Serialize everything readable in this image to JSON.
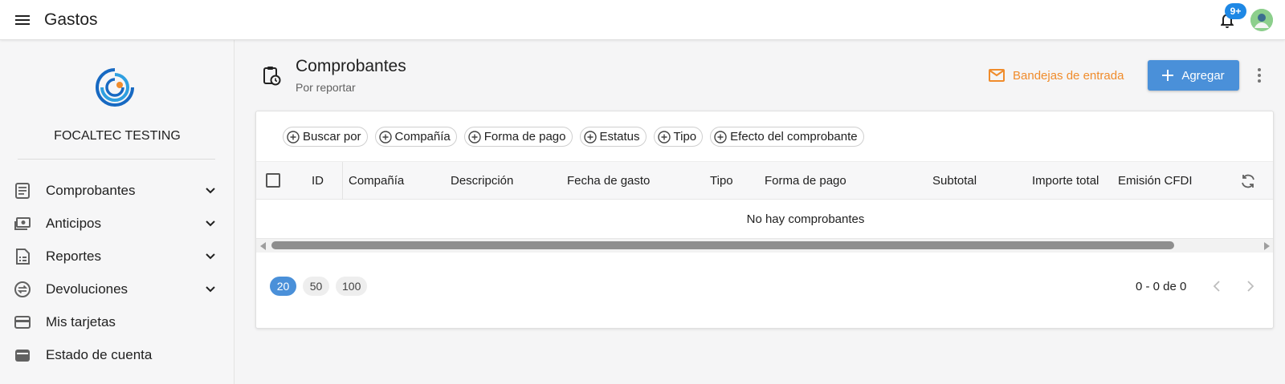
{
  "app": {
    "title": "Gastos",
    "notifications_badge": "9+"
  },
  "colors": {
    "primary": "#4a90d9",
    "accent": "#f08c2c",
    "badge": "#1e88e5"
  },
  "sidebar": {
    "org_name": "FOCALTEC TESTING",
    "items": [
      {
        "label": "Comprobantes",
        "icon": "receipt-icon",
        "expandable": true
      },
      {
        "label": "Anticipos",
        "icon": "cash-icon",
        "expandable": true
      },
      {
        "label": "Reportes",
        "icon": "report-icon",
        "expandable": true
      },
      {
        "label": "Devoluciones",
        "icon": "exchange-icon",
        "expandable": true
      },
      {
        "label": "Mis tarjetas",
        "icon": "credit-card-icon",
        "expandable": false
      },
      {
        "label": "Estado de cuenta",
        "icon": "wallet-icon",
        "expandable": false
      }
    ]
  },
  "header": {
    "title": "Comprobantes",
    "subtitle": "Por reportar",
    "inbox_label": "Bandejas de entrada",
    "add_label": "Agregar"
  },
  "filters": [
    "Buscar por",
    "Compañía",
    "Forma de pago",
    "Estatus",
    "Tipo",
    "Efecto del comprobante"
  ],
  "table": {
    "columns": [
      "ID",
      "Compañía",
      "Descripción",
      "Fecha de gasto",
      "Tipo",
      "Forma de pago",
      "Subtotal",
      "Importe total",
      "Emisión CFDI"
    ],
    "empty_message": "No hay comprobantes"
  },
  "pagination": {
    "page_sizes": [
      "20",
      "50",
      "100"
    ],
    "selected_size": "20",
    "range": "0 - 0 de 0"
  }
}
